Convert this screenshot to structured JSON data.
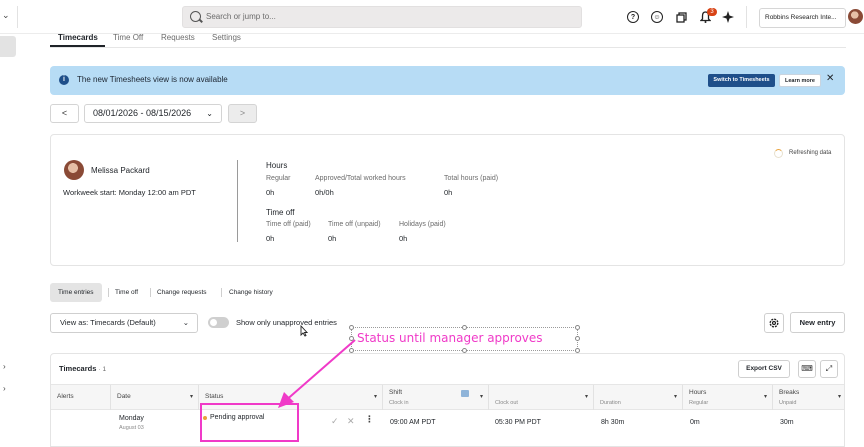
{
  "topbar": {
    "collapse_glyph": "⌄",
    "search_placeholder": "Search or jump to...",
    "notification_count": "3",
    "org_name": "Robbins Research Inte...",
    "icons": [
      "help-icon",
      "accessibility-icon",
      "copy-icon",
      "bell-icon",
      "sparkle-icon"
    ]
  },
  "tabs": [
    {
      "label": "Timecards",
      "active": true
    },
    {
      "label": "Time Off",
      "active": false
    },
    {
      "label": "Requests",
      "active": false
    },
    {
      "label": "Settings",
      "active": false
    }
  ],
  "banner": {
    "message": "The new Timesheets view is now available",
    "primary_button": "Switch to Timesheets",
    "secondary_button": "Learn more",
    "close_glyph": "✕"
  },
  "date_nav": {
    "prev_glyph": "<",
    "next_glyph": ">",
    "range": "08/01/2026 - 08/15/2026"
  },
  "summary": {
    "employee_name": "Melissa Packard",
    "workweek": "Workweek start: Monday 12:00 am PDT",
    "refresh_label": "Refreshing data",
    "hours_title": "Hours",
    "hours": [
      {
        "label": "Regular",
        "value": "0h"
      },
      {
        "label": "Approved/Total worked hours",
        "value": "0h/0h"
      },
      {
        "label": "Total hours (paid)",
        "value": "0h"
      }
    ],
    "timeoff_title": "Time off",
    "timeoff": [
      {
        "label": "Time off (paid)",
        "value": "0h"
      },
      {
        "label": "Time off (unpaid)",
        "value": "0h"
      },
      {
        "label": "Holidays (paid)",
        "value": "0h"
      }
    ]
  },
  "subtabs": [
    {
      "label": "Time entries",
      "active": true
    },
    {
      "label": "Time off",
      "active": false
    },
    {
      "label": "Change requests",
      "active": false
    },
    {
      "label": "Change history",
      "active": false
    }
  ],
  "filters": {
    "view_select": "View as: Timecards (Default)",
    "toggle_label": "Show only unapproved entries",
    "toggle_on": false,
    "new_entry": "New entry"
  },
  "annotation": {
    "text": "Status until manager approves",
    "color": "#f03ac8"
  },
  "table": {
    "title": "Timecards",
    "count": "· 1",
    "export_label": "Export CSV",
    "columns": [
      {
        "label": "Alerts",
        "sub": ""
      },
      {
        "label": "Date",
        "sub": ""
      },
      {
        "label": "Status",
        "sub": ""
      },
      {
        "label": "Shift",
        "sub": "Clock in"
      },
      {
        "label": "",
        "sub": "Clock out"
      },
      {
        "label": "",
        "sub": "Duration"
      },
      {
        "label": "Hours",
        "sub": "Regular"
      },
      {
        "label": "Breaks",
        "sub": "Unpaid"
      }
    ],
    "rows": [
      {
        "day": "Monday",
        "date": "August 03",
        "status": "Pending approval",
        "clock_in": "09:00 AM PDT",
        "clock_out": "05:30 PM PDT",
        "duration": "8h 30m",
        "regular": "0m",
        "unpaid": "30m"
      }
    ]
  },
  "colors": {
    "banner_bg": "#b7dcf5",
    "primary_blue": "#1f4f8a",
    "pending_dot": "#e9a23b",
    "annotation_pink": "#f03ac8"
  }
}
